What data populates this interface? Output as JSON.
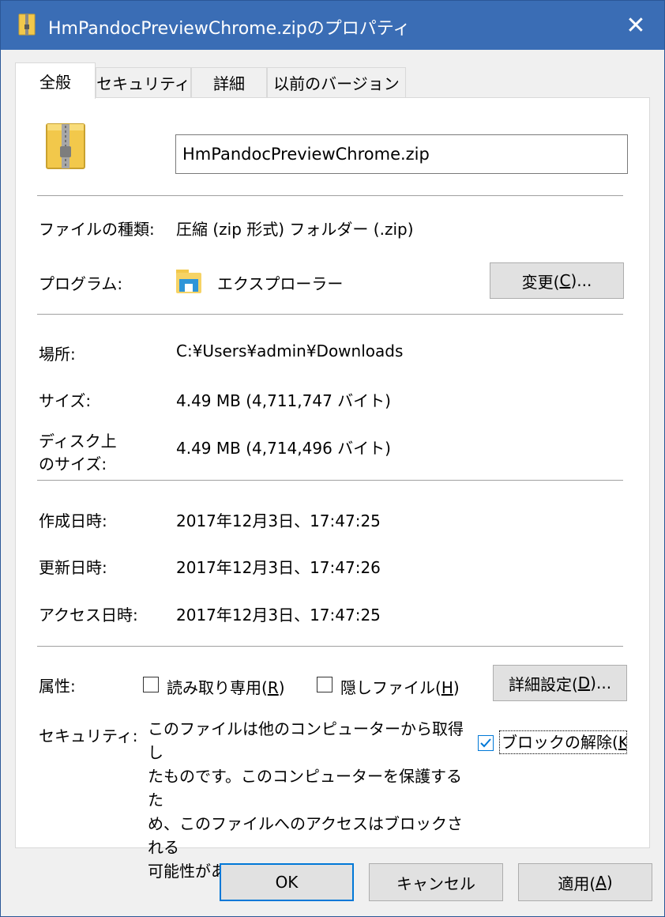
{
  "window": {
    "title": "HmPandocPreviewChrome.zipのプロパティ",
    "close_glyph": "✕"
  },
  "tabs": [
    {
      "label": "全般",
      "active": true
    },
    {
      "label": "セキュリティ",
      "active": false
    },
    {
      "label": "詳細",
      "active": false
    },
    {
      "label": "以前のバージョン",
      "active": false
    }
  ],
  "general": {
    "filename": "HmPandocPreviewChrome.zip",
    "file_type_label": "ファイルの種類:",
    "file_type_value": "圧縮 (zip 形式) フォルダー (.zip)",
    "program_label": "プログラム:",
    "program_value": "エクスプローラー",
    "change_button": {
      "pre": "変更(",
      "key": "C",
      "post": ")..."
    },
    "location_label": "場所:",
    "location_value": "C:¥Users¥admin¥Downloads",
    "size_label": "サイズ:",
    "size_value": "4.49 MB (4,711,747 バイト)",
    "disk_size_label_1": "ディスク上",
    "disk_size_label_2": "のサイズ:",
    "disk_size_value": "4.49 MB (4,714,496 バイト)",
    "created_label": "作成日時:",
    "created_value": "2017年12月3日、17:47:25",
    "modified_label": "更新日時:",
    "modified_value": "2017年12月3日、17:47:26",
    "accessed_label": "アクセス日時:",
    "accessed_value": "2017年12月3日、17:47:25",
    "attributes_label": "属性:",
    "readonly": {
      "pre": "読み取り専用(",
      "key": "R",
      "post": ")",
      "checked": false
    },
    "hidden": {
      "pre": "隠しファイル(",
      "key": "H",
      "post": ")",
      "checked": false
    },
    "advanced_button": {
      "pre": "詳細設定(",
      "key": "D",
      "post": ")..."
    },
    "security_label": "セキュリティ:",
    "security_text_lines": [
      "このファイルは他のコンピューターから取得し",
      "たものです。このコンピューターを保護するた",
      "め、このファイルへのアクセスはブロックされる",
      "可能性があります。"
    ],
    "unblock": {
      "pre": "ブロックの解除(",
      "key": "K",
      "checked": true
    }
  },
  "footer": {
    "ok_label": "OK",
    "cancel_label": "キャンセル",
    "apply_button": {
      "pre": "適用(",
      "key": "A",
      "post": ")"
    }
  },
  "colors": {
    "titlebar": "#3a6db5",
    "focus": "#0078d7",
    "zip_folder": "#f2c84b",
    "zipper": "#7d7d7d"
  },
  "icons": {
    "title": "zip-folder-icon",
    "file": "zip-folder-icon",
    "program": "file-explorer-icon",
    "check": "checkmark-icon"
  }
}
